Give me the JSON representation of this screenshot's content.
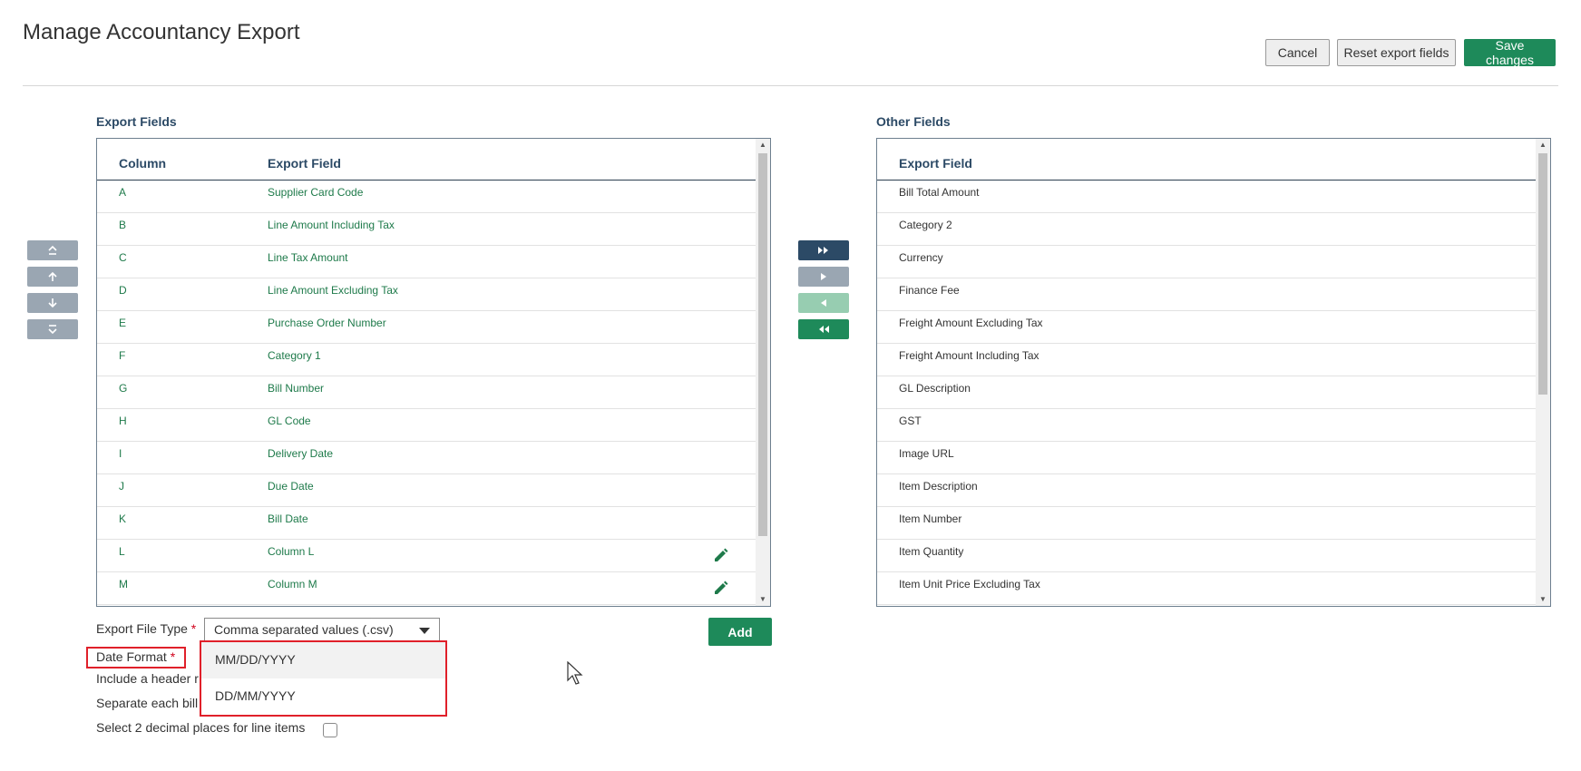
{
  "page": {
    "title": "Manage Accountancy Export"
  },
  "header": {
    "cancel_label": "Cancel",
    "reset_label": "Reset export fields",
    "save_label": "Save changes"
  },
  "export_fields": {
    "title": "Export Fields",
    "col_header": "Column",
    "field_header": "Export Field",
    "rows": [
      {
        "column": "A",
        "field": "Supplier Card Code",
        "editable": false
      },
      {
        "column": "B",
        "field": "Line Amount Including Tax",
        "editable": false
      },
      {
        "column": "C",
        "field": "Line Tax Amount",
        "editable": false
      },
      {
        "column": "D",
        "field": "Line Amount Excluding Tax",
        "editable": false
      },
      {
        "column": "E",
        "field": "Purchase Order Number",
        "editable": false
      },
      {
        "column": "F",
        "field": "Category 1",
        "editable": false
      },
      {
        "column": "G",
        "field": "Bill Number",
        "editable": false
      },
      {
        "column": "H",
        "field": "GL Code",
        "editable": false
      },
      {
        "column": "I",
        "field": "Delivery Date",
        "editable": false
      },
      {
        "column": "J",
        "field": "Due Date",
        "editable": false
      },
      {
        "column": "K",
        "field": "Bill Date",
        "editable": false
      },
      {
        "column": "L",
        "field": "Column L",
        "editable": true
      },
      {
        "column": "M",
        "field": "Column M",
        "editable": true
      }
    ]
  },
  "other_fields": {
    "title": "Other Fields",
    "field_header": "Export Field",
    "rows": [
      "Bill Total Amount",
      "Category 2",
      "Currency",
      "Finance Fee",
      "Freight Amount Excluding Tax",
      "Freight Amount Including Tax",
      "GL Description",
      "GST",
      "Image URL",
      "Item Description",
      "Item Number",
      "Item Quantity",
      "Item Unit Price Excluding Tax"
    ]
  },
  "form": {
    "file_type_label": "Export File Type",
    "file_type_value": "Comma separated values (.csv)",
    "date_format_label": "Date Format",
    "header_row_label": "Include a header r",
    "separate_label": "Separate each bill",
    "decimal_label": "Select 2 decimal places for line items",
    "required_mark": "*",
    "add_label": "Add",
    "date_options": [
      "MM/DD/YYYY",
      "DD/MM/YYYY"
    ]
  },
  "colors": {
    "primary": "#1e8a5a",
    "navy": "#2c4a66",
    "export_text": "#1e7a4a",
    "highlight": "#e0202a"
  }
}
